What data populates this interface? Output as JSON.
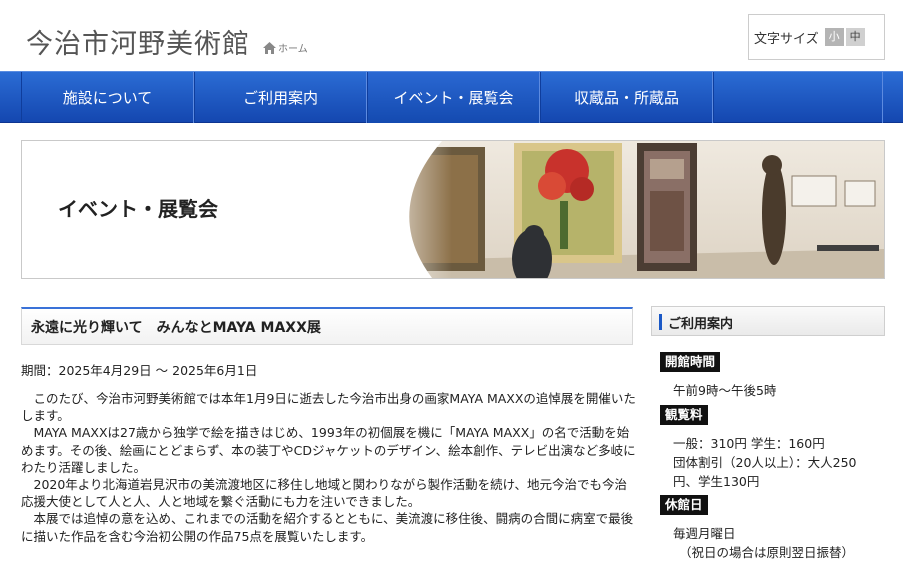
{
  "header": {
    "logo_main": "今治市",
    "logo_rest": "河野美術館",
    "home_label": "ホーム",
    "fontsize_label": "文字サイズ",
    "fontsize_small": "小",
    "fontsize_medium": "中"
  },
  "nav": {
    "items": [
      "施設について",
      "ご利用案内",
      "イベント・展覧会",
      "収蔵品・所蔵品"
    ],
    "active_index": 2
  },
  "hero": {
    "title": "イベント・展覧会"
  },
  "main": {
    "event_title": "永遠に光り輝いて　みんなとMAYA MAXX展",
    "period": "期間：2025年4月29日 ～ 2025年6月1日",
    "paragraphs": [
      "このたび、今治市河野美術館では本年1月9日に逝去した今治市出身の画家MAYA MAXXの追悼展を開催いたします。",
      "MAYA MAXXは27歳から独学で絵を描きはじめ、1993年の初個展を機に「MAYA MAXX」の名で活動を始めます。その後、絵画にとどまらず、本の装丁やCDジャケットのデザイン、絵本創作、テレビ出演など多岐にわたり活躍しました。",
      "2020年より北海道岩見沢市の美流渡地区に移住し地域と関わりながら製作活動を続け、地元今治でも今治応援大使として人と人、人と地域を繋ぐ活動にも力を注いできました。",
      "本展では追悼の意を込め、これまでの活動を紹介するとともに、美流渡に移住後、闘病の合間に病室で最後に描いた作品を含む今治初公開の作品75点を展覧いたします。"
    ]
  },
  "sidebar": {
    "title": "ご利用案内",
    "hours_label": "開館時間",
    "hours": "午前9時～午後5時",
    "fee_label": "観覧料",
    "fee_line1": "一般：310円 学生：160円",
    "fee_line2": "団体割引（20人以上）：大人250",
    "fee_line3": "円、学生130円",
    "closed_label": "休館日",
    "closed_line1": "毎週月曜日",
    "closed_line2": "（祝日の場合は原則翌日振替）"
  },
  "colors": {
    "nav_blue": "#1f5cc6",
    "accent_blue": "#3a72d8",
    "badge_black": "#111111"
  }
}
